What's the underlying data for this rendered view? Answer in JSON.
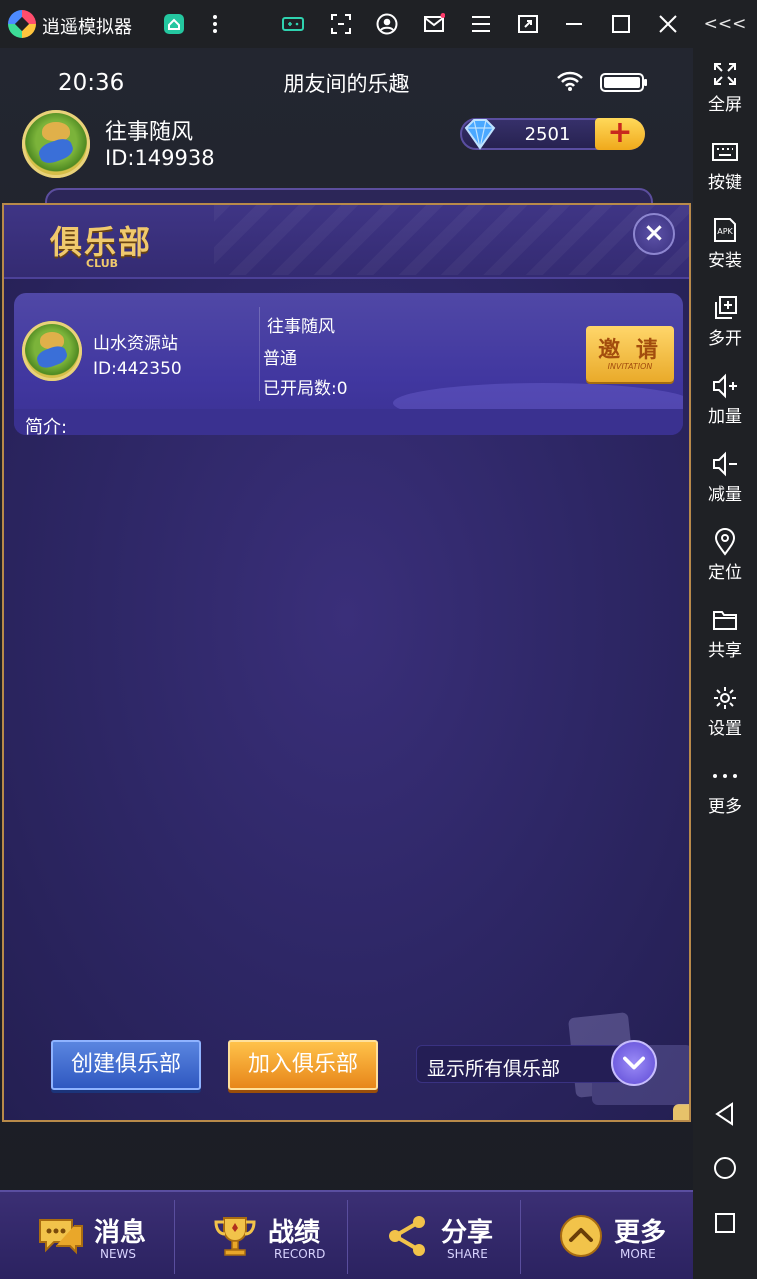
{
  "emulator": {
    "app_name": "逍遥模拟器",
    "sidebar": [
      {
        "label": "全屏",
        "icon": "fullscreen-icon"
      },
      {
        "label": "按键",
        "icon": "keyboard-icon"
      },
      {
        "label": "安装",
        "icon": "apk-icon"
      },
      {
        "label": "多开",
        "icon": "multi-instance-icon"
      },
      {
        "label": "加量",
        "icon": "volume-up-icon"
      },
      {
        "label": "减量",
        "icon": "volume-down-icon"
      },
      {
        "label": "定位",
        "icon": "location-icon"
      },
      {
        "label": "共享",
        "icon": "folder-icon"
      },
      {
        "label": "设置",
        "icon": "gear-icon"
      },
      {
        "label": "更多",
        "icon": "more-icon"
      }
    ],
    "apk_text": "APK",
    "collapse_text": "<<<"
  },
  "status_bar": {
    "time": "20:36",
    "title": "朋友间的乐趣"
  },
  "user": {
    "name": "往事随风",
    "id": "ID:149938",
    "diamonds": "2501",
    "plus": "+"
  },
  "club_dialog": {
    "title": "俱乐部",
    "subtitle": "CLUB",
    "close": "×",
    "club": {
      "name": "山水资源站",
      "id": "ID:442350",
      "owner": "往事随风",
      "level": "普通",
      "games_opened": "已开局数:0",
      "intro_label": "简介:"
    },
    "invite": {
      "label": "邀 请",
      "sub": "INVITATION"
    },
    "create_button": "创建俱乐部",
    "join_button": "加入俱乐部",
    "show_all": "显示所有俱乐部"
  },
  "bottom_nav": [
    {
      "cn": "消息",
      "en": "NEWS",
      "icon": "message-icon"
    },
    {
      "cn": "战绩",
      "en": "RECORD",
      "icon": "trophy-icon"
    },
    {
      "cn": "分享",
      "en": "SHARE",
      "icon": "share-icon"
    },
    {
      "cn": "更多",
      "en": "MORE",
      "icon": "more-up-icon"
    }
  ],
  "colors": {
    "accent_gold": "#f0c96d",
    "dialog_bg": "#2e2766",
    "button_blue": "#2f58c0",
    "button_orange": "#e7861a"
  }
}
